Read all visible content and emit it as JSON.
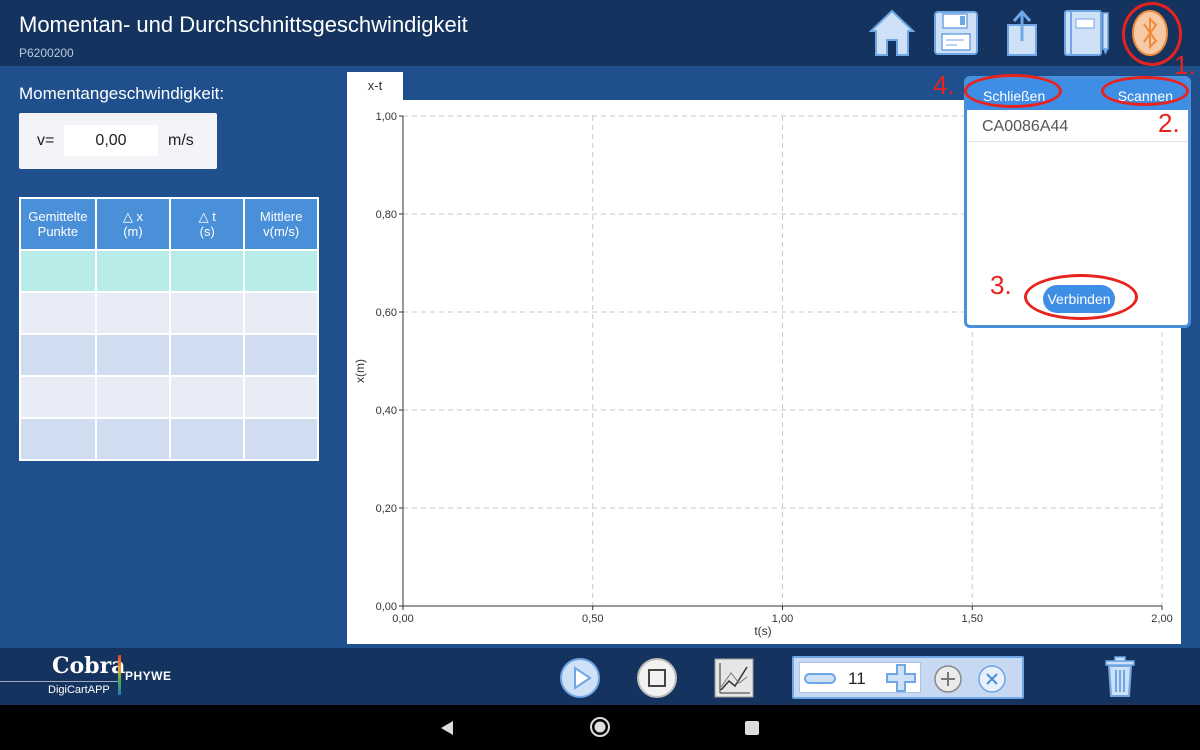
{
  "header": {
    "title": "Momentan- und Durchschnittsgeschwindigkeit",
    "code": "P6200200",
    "icons": [
      "home-icon",
      "save-icon",
      "export-icon",
      "notebook-icon",
      "bluetooth-icon"
    ]
  },
  "momentary": {
    "label": "Momentangeschwindigkeit:",
    "v_label": "v=",
    "v_value": "0,00",
    "v_unit": "m/s"
  },
  "avg_table": {
    "headers": [
      {
        "line1": "Gemittelte",
        "line2": "Punkte"
      },
      {
        "line1": "△ x",
        "line2": "(m)"
      },
      {
        "line1": "△ t",
        "line2": "(s)"
      },
      {
        "line1": "Mittlere",
        "line2": "v(m/s)"
      }
    ],
    "rows": [
      [
        "",
        "",
        "",
        ""
      ],
      [
        "",
        "",
        "",
        ""
      ],
      [
        "",
        "",
        "",
        ""
      ],
      [
        "",
        "",
        "",
        ""
      ],
      [
        "",
        "",
        "",
        ""
      ]
    ]
  },
  "chart_tab": "x-t",
  "chart_data": {
    "type": "line",
    "series": [],
    "xlabel": "t(s)",
    "ylabel": "x(m)",
    "xlim": [
      0,
      2
    ],
    "ylim": [
      0,
      1
    ],
    "xticks": [
      "0,00",
      "0,50",
      "1,00",
      "1,50",
      "2,00"
    ],
    "yticks": [
      "0,00",
      "0,20",
      "0,40",
      "0,60",
      "0,80",
      "1,00"
    ],
    "grid": true
  },
  "bluetooth_popup": {
    "close_label": "Schließen",
    "scan_label": "Scannen",
    "device": "CA0086A44",
    "connect_label": "Verbinden"
  },
  "annotations": [
    "1.",
    "2.",
    "3.",
    "4."
  ],
  "bottom": {
    "logo_main": "Cobra",
    "logo_sub": "DigiCartAPP",
    "logo_brand": "PHYWE",
    "stepper_value": "11",
    "icons": [
      "play-icon",
      "stop-icon",
      "chart-icon",
      "minus-icon",
      "plus-icon",
      "add-circle-icon",
      "close-circle-icon",
      "trash-icon"
    ]
  },
  "android_nav": [
    "back-icon",
    "home-circle-icon",
    "recents-icon"
  ],
  "colors": {
    "header_bg": "#14345f",
    "body_bg": "#1f4f8c",
    "accent": "#3f8ee6",
    "annotation": "#e8221d"
  }
}
